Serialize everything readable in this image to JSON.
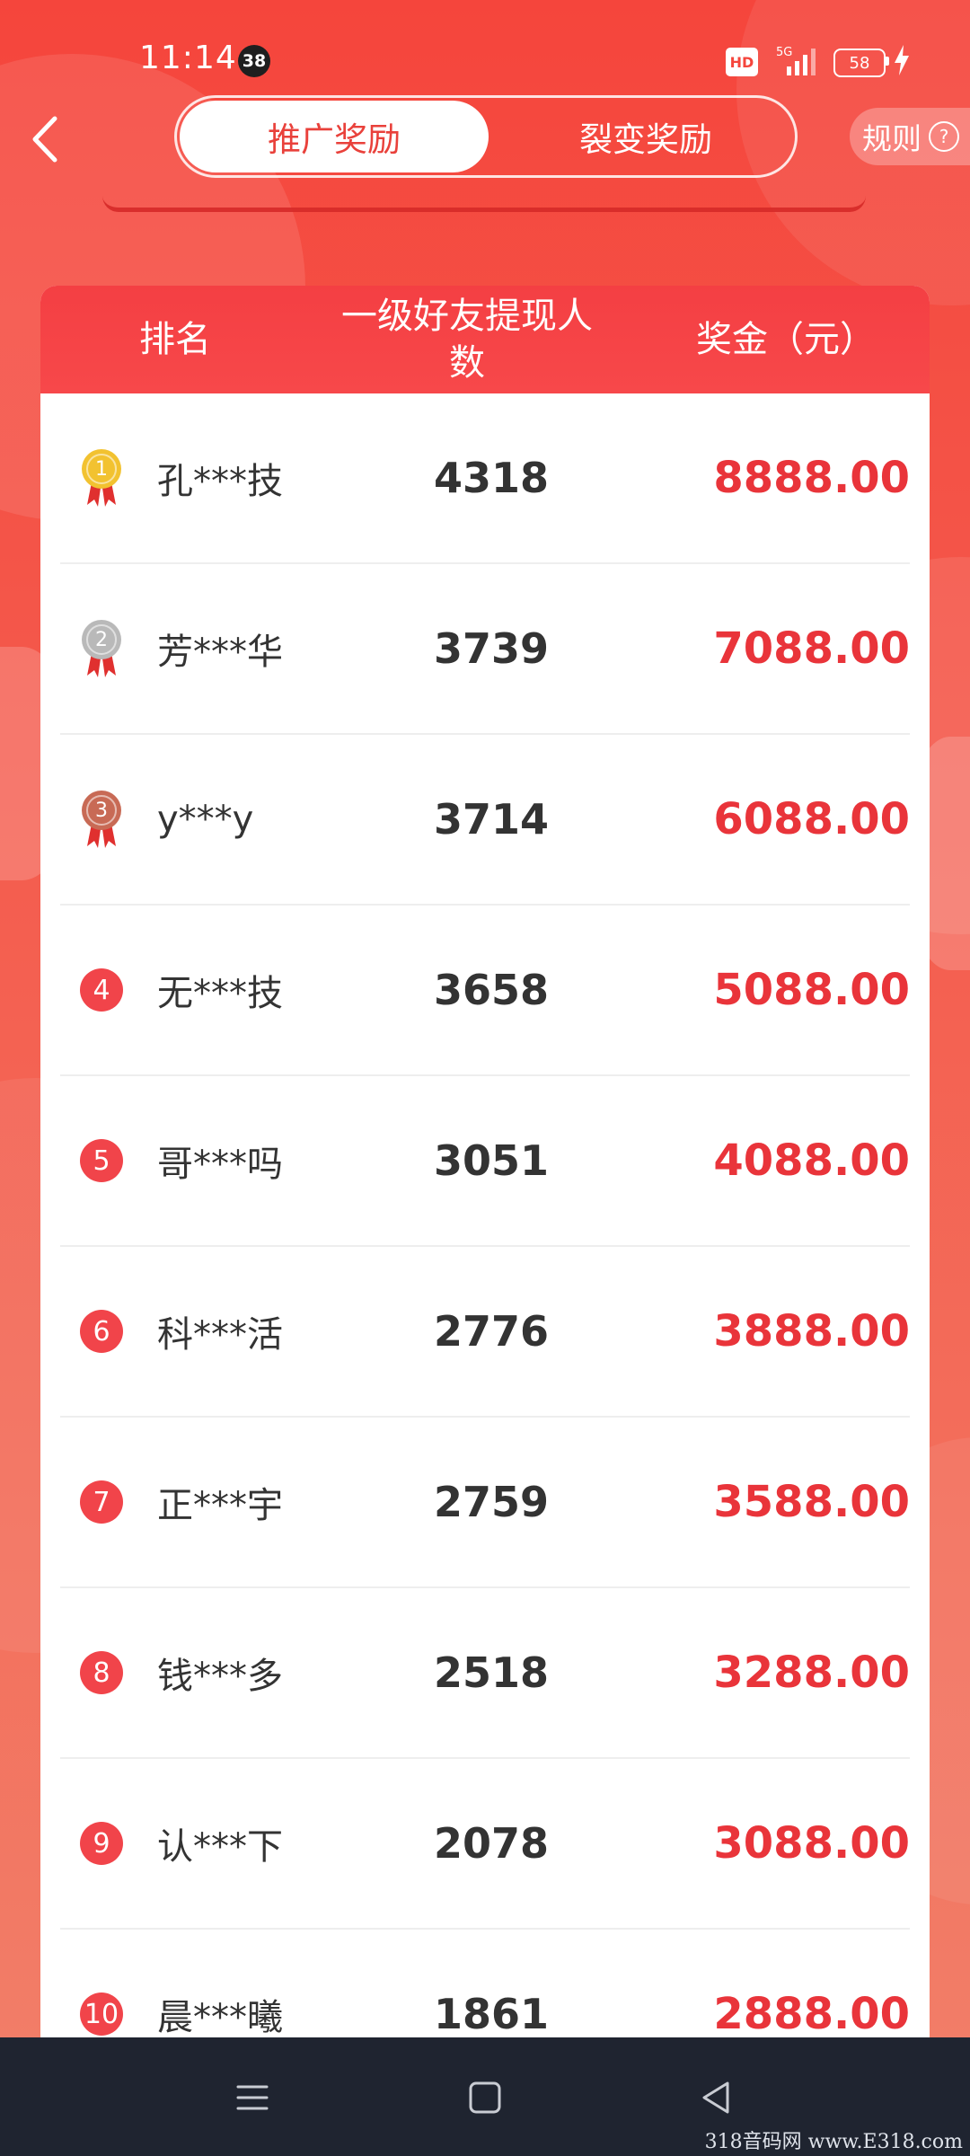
{
  "status_bar": {
    "time": "11:14",
    "notification_count": "38",
    "hd_label": "HD",
    "network_label": "5G",
    "battery": "58"
  },
  "header": {
    "tabs": [
      {
        "label": "推广奖励",
        "active": true
      },
      {
        "label": "裂变奖励",
        "active": false
      }
    ],
    "rules_label": "规则",
    "help_symbol": "?"
  },
  "leaderboard": {
    "columns": [
      "排名",
      "一级好友提现人数",
      "奖金（元）"
    ],
    "rows": [
      {
        "rank": "1",
        "medal": "gold",
        "name": "孔***技",
        "count": "4318",
        "bonus": "8888.00"
      },
      {
        "rank": "2",
        "medal": "silver",
        "name": "芳***华",
        "count": "3739",
        "bonus": "7088.00"
      },
      {
        "rank": "3",
        "medal": "bronze",
        "name": "y***y",
        "count": "3714",
        "bonus": "6088.00"
      },
      {
        "rank": "4",
        "medal": "",
        "name": "无***技",
        "count": "3658",
        "bonus": "5088.00"
      },
      {
        "rank": "5",
        "medal": "",
        "name": "哥***吗",
        "count": "3051",
        "bonus": "4088.00"
      },
      {
        "rank": "6",
        "medal": "",
        "name": "科***活",
        "count": "2776",
        "bonus": "3888.00"
      },
      {
        "rank": "7",
        "medal": "",
        "name": "正***宇",
        "count": "2759",
        "bonus": "3588.00"
      },
      {
        "rank": "8",
        "medal": "",
        "name": "钱***多",
        "count": "2518",
        "bonus": "3288.00"
      },
      {
        "rank": "9",
        "medal": "",
        "name": "认***下",
        "count": "2078",
        "bonus": "3088.00"
      },
      {
        "rank": "10",
        "medal": "",
        "name": "晨***曦",
        "count": "1861",
        "bonus": "2888.00"
      }
    ]
  },
  "watermark": "318音码网 www.E318.com",
  "colors": {
    "accent_red": "#e9343a",
    "header_red": "#f43f43",
    "gold": "#f2c230",
    "silver": "#b9b9b9",
    "bronze": "#c86a55"
  }
}
